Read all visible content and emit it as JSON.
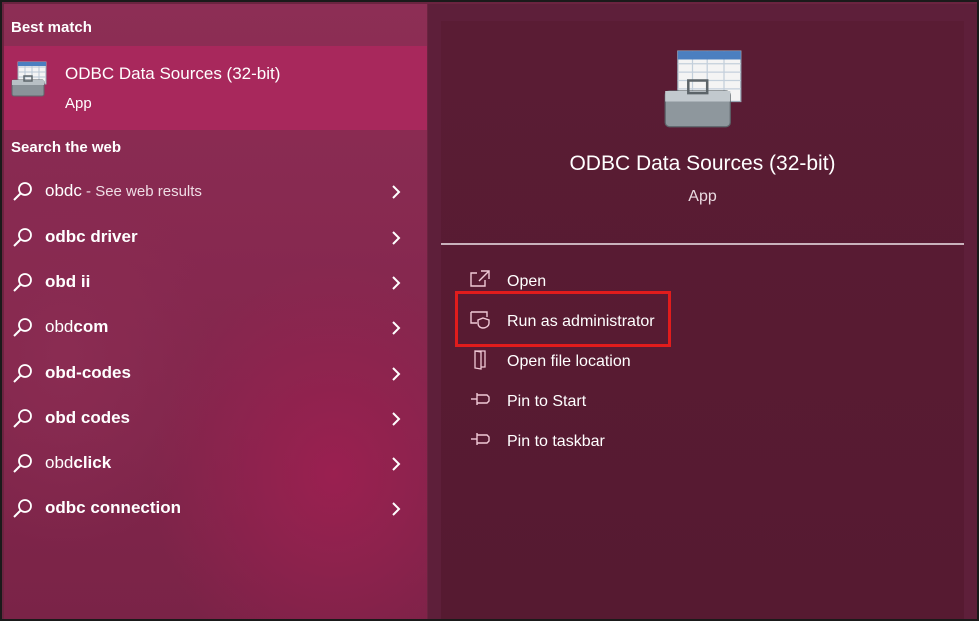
{
  "left_pane": {
    "best_match_label": "Best match",
    "best_match": {
      "title": "ODBC Data Sources (32-bit)",
      "subtitle": "App",
      "icon": "odbc-toolbox-icon"
    },
    "web_label": "Search the web",
    "web_results": [
      {
        "text": "obdc",
        "suffix": " - See web results",
        "bold": false
      },
      {
        "text": "odbc driver",
        "suffix": "",
        "bold": true
      },
      {
        "text": "obd ii",
        "suffix": "",
        "bold": true
      },
      {
        "text": "obd",
        "bold_part": "com",
        "suffix": "",
        "bold": false,
        "mixed": true
      },
      {
        "text": "obd-codes",
        "suffix": "",
        "bold": true
      },
      {
        "text": "obd codes",
        "suffix": "",
        "bold": true
      },
      {
        "text": "obd",
        "bold_part": "click",
        "suffix": "",
        "bold": false,
        "mixed": true
      },
      {
        "text": "odbc connection",
        "suffix": "",
        "bold": true
      }
    ]
  },
  "right_pane": {
    "title": "ODBC Data Sources (32-bit)",
    "subtitle": "App",
    "actions": [
      {
        "label": "Open",
        "icon": "open-external-icon"
      },
      {
        "label": "Run as administrator",
        "icon": "shield-admin-icon"
      },
      {
        "label": "Open file location",
        "icon": "folder-icon"
      },
      {
        "label": "Pin to Start",
        "icon": "pin-icon"
      },
      {
        "label": "Pin to taskbar",
        "icon": "pin-icon"
      }
    ]
  },
  "colors": {
    "left_bg": "#86284f",
    "best_match_bg": "#a8285c",
    "right_bg": "#561a31",
    "highlight": "#e11c1c"
  }
}
